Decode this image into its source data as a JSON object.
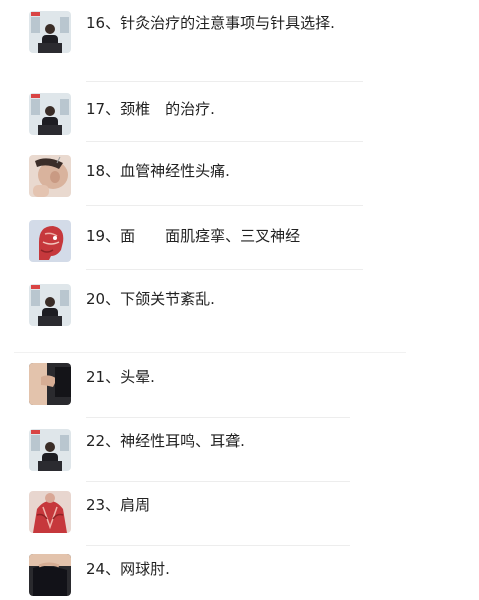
{
  "lessons": [
    {
      "title": "16、针灸治疗的注意事项与针具选择.",
      "thumb_icon": "lecture-video-thumbnail-icon"
    },
    {
      "title": "17、颈椎　的治疗.",
      "thumb_icon": "lecture-video-thumbnail-icon"
    },
    {
      "title": "18、血管神经性头痛.",
      "thumb_icon": "head-acupuncture-photo-icon"
    },
    {
      "title": "19、面　　面肌痉挛、三叉神经",
      "thumb_icon": "facial-anatomy-icon"
    },
    {
      "title": "20、下颌关节紊乱.",
      "thumb_icon": "lecture-video-thumbnail-icon"
    },
    {
      "title": "21、头晕.",
      "thumb_icon": "hand-treatment-photo-icon"
    },
    {
      "title": "22、神经性耳鸣、耳聋.",
      "thumb_icon": "lecture-video-thumbnail-icon"
    },
    {
      "title": "23、肩周",
      "thumb_icon": "shoulder-muscle-anatomy-icon"
    },
    {
      "title": "24、网球肘.",
      "thumb_icon": "elbow-treatment-photo-icon"
    }
  ],
  "colors": {
    "text": "#222222",
    "divider": "#ededed",
    "lecture_backdrop": "#dfe6ea",
    "anatomy_red": "#c6383c"
  }
}
